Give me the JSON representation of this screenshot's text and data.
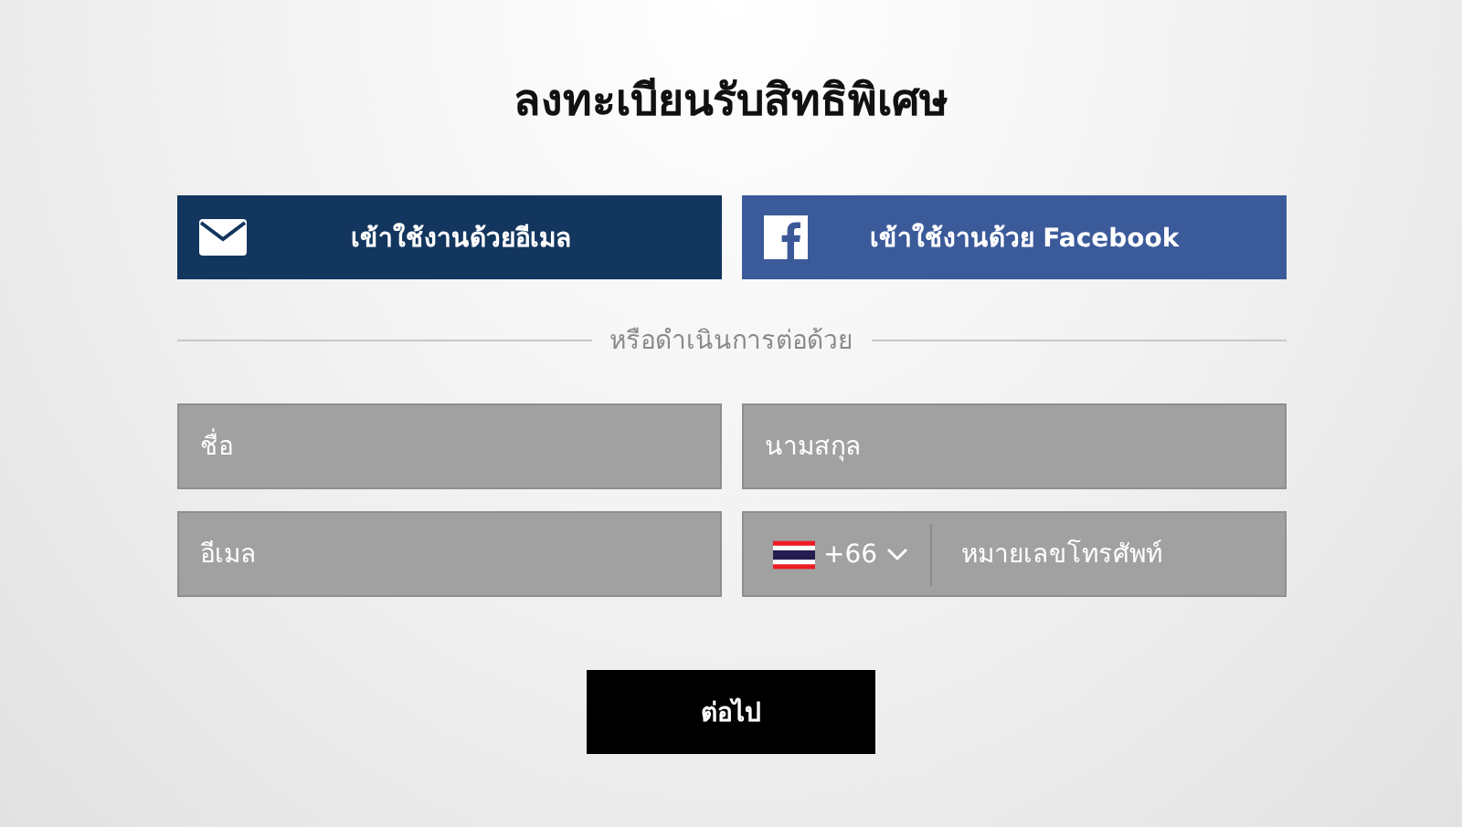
{
  "title": "ลงทะเบียนรับสิทธิพิเศษ",
  "social_buttons": [
    {
      "kind": "email",
      "label": "เข้าใช้งานด้วยอีเมล"
    },
    {
      "kind": "facebook",
      "label": "เข้าใช้งานด้วย Facebook"
    }
  ],
  "divider": "หรือดำเนินการต่อด้วย",
  "fields": {
    "first_name": {
      "placeholder": "ชื่อ"
    },
    "last_name": {
      "placeholder": "นามสกุล"
    },
    "email": {
      "placeholder": "อีเมล"
    },
    "phone": {
      "country_code": "+66",
      "placeholder": "หมายเลขโทรศัพท์"
    }
  },
  "next_button": "ต่อไป"
}
